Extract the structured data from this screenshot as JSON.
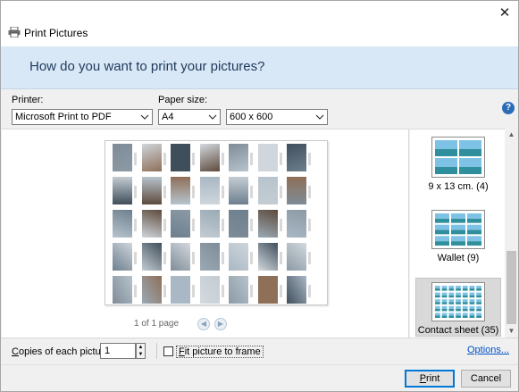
{
  "window": {
    "title": "Print Pictures",
    "close_symbol": "✕"
  },
  "banner": {
    "heading": "How do you want to print your pictures?"
  },
  "printer": {
    "label": "Printer:",
    "value": "Microsoft Print to PDF"
  },
  "paper_size": {
    "label": "Paper size:",
    "value": "A4"
  },
  "quality": {
    "value": "600 x 600"
  },
  "help": {
    "symbol": "?"
  },
  "preview": {
    "page_status": "1 of 1 page",
    "prev_symbol": "◀",
    "next_symbol": "▶",
    "thumb_palette": [
      "#7f8c98",
      "#5e4a3c",
      "#a9b8c4",
      "#cfd6dc",
      "#8b9aa5",
      "#c4ccd2",
      "#3f4e5b",
      "#9aaab5",
      "#b7c4cd",
      "#d3d9de",
      "#6d7f8e",
      "#8e6f58"
    ]
  },
  "layouts": [
    {
      "caption": "9 x 13 cm. (4)",
      "cols": 2,
      "rows": 2
    },
    {
      "caption": "Wallet (9)",
      "cols": 3,
      "rows": 3
    },
    {
      "caption": "Contact sheet (35)",
      "cols": 7,
      "rows": 5,
      "selected": true
    }
  ],
  "scrollbar": {
    "up_symbol": "▲",
    "down_symbol": "▼"
  },
  "copies": {
    "label_prefix": "C",
    "label_rest": "opies of each picture:",
    "value": "1",
    "up_symbol": "▲",
    "down_symbol": "▼"
  },
  "fit": {
    "label_prefix": "F",
    "label_rest": "it picture to frame",
    "checked": false
  },
  "options_link": "Options...",
  "buttons": {
    "print_prefix": "P",
    "print_rest": "rint",
    "cancel": "Cancel"
  },
  "colors": {
    "banner": "#d9e8f6",
    "heading": "#1e395b",
    "link": "#0050c8",
    "default_button_border": "#0078d7"
  }
}
